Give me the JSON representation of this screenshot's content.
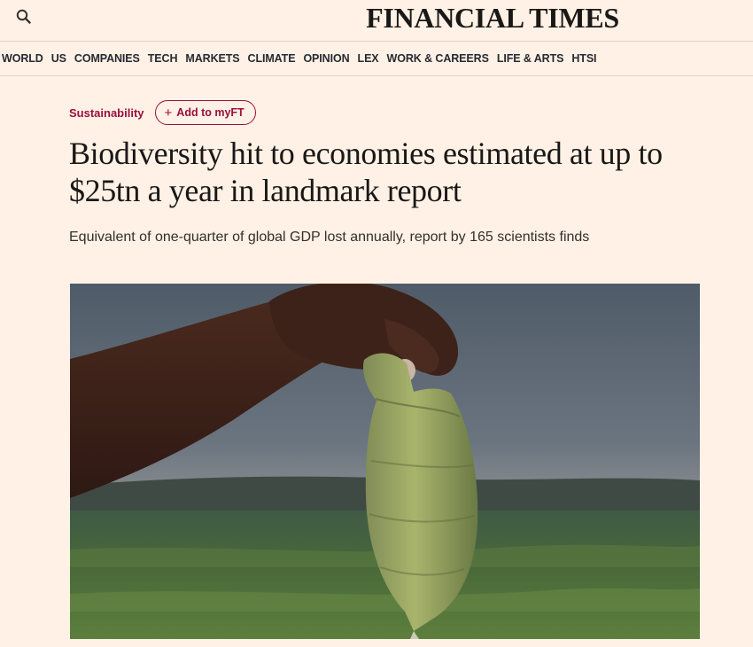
{
  "header": {
    "masthead": "FINANCIAL TIMES",
    "search_icon": "search-icon"
  },
  "nav": {
    "items": [
      "WORLD",
      "US",
      "COMPANIES",
      "TECH",
      "MARKETS",
      "CLIMATE",
      "OPINION",
      "LEX",
      "WORK & CAREERS",
      "LIFE & ARTS",
      "HTSI"
    ]
  },
  "article": {
    "topic": "Sustainability",
    "myft_label": "Add to myFT",
    "myft_icon": "plus-icon",
    "headline": "Biodiversity hit to economies estimated at up to $25tn a year in landmark report",
    "standfirst": "Equivalent of one-quarter of global GDP lost annually, report by 165 scientists finds",
    "hero_image": "hand-holding-algae-covered-fish-photo"
  },
  "colors": {
    "background": "#fff1e5",
    "accent": "#990f3d",
    "text": "#33302e"
  }
}
